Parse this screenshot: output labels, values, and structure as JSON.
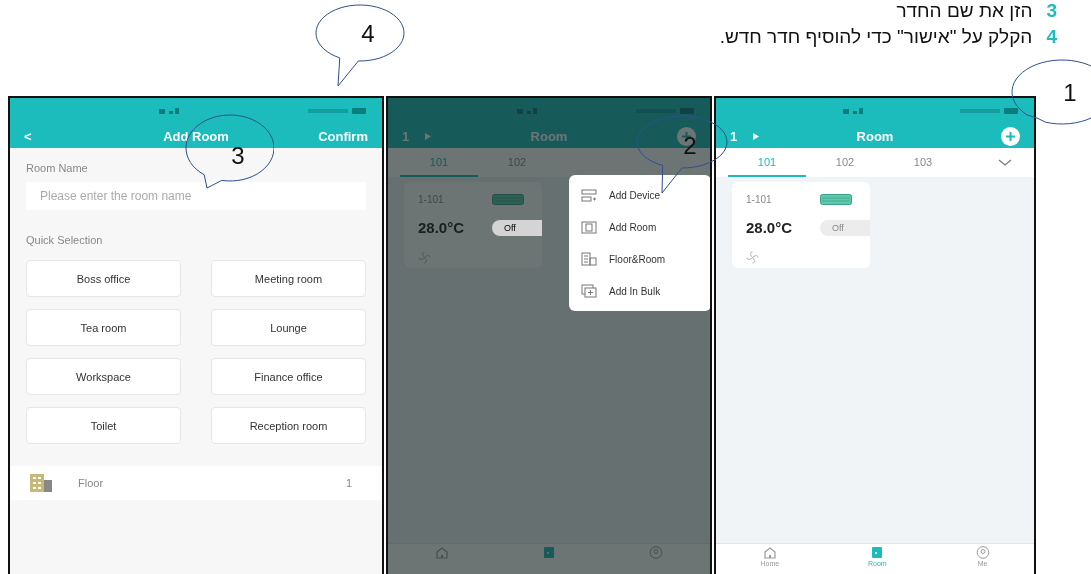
{
  "instructions": [
    {
      "number": "3",
      "text": "הזן את שם החדר"
    },
    {
      "number": "4",
      "text": "הקלק על \"אישור\" כדי להוסיף חדר חדש."
    }
  ],
  "screens": [
    {
      "kind": "add_room",
      "header": {
        "back": "<",
        "title": "Add Room",
        "action": "Confirm"
      },
      "room_name_label": "Room Name",
      "room_name_field": {
        "placeholder": "Please enter the room name"
      },
      "quick_selection_label": "Quick Selection",
      "quick_options": [
        "Boss office",
        "Meeting room",
        "Tea room",
        "Lounge",
        "Workspace",
        "Finance office",
        "Toilet",
        "Reception room"
      ],
      "floor": {
        "label": "Floor",
        "value": "1"
      }
    },
    {
      "kind": "room_menu",
      "header": {
        "floor": "1",
        "title": "Room"
      },
      "tabs": [
        {
          "label": "101",
          "selected": true
        },
        {
          "label": "102",
          "selected": false
        }
      ],
      "device_card": {
        "name": "1-101",
        "temperature": "28.0°C",
        "status": "Off"
      },
      "menu": [
        {
          "kind": "device",
          "label": "Add Device"
        },
        {
          "kind": "room",
          "label": "Add Room"
        },
        {
          "kind": "floor",
          "label": "Floor&Room"
        },
        {
          "kind": "bulk",
          "label": "Add In Bulk"
        }
      ],
      "nav": [
        {
          "kind": "home",
          "selected": false
        },
        {
          "kind": "room",
          "selected": true
        },
        {
          "kind": "me",
          "selected": false
        }
      ]
    },
    {
      "kind": "room",
      "header": {
        "floor": "1",
        "title": "Room"
      },
      "tabs": [
        {
          "label": "101",
          "selected": true
        },
        {
          "label": "102",
          "selected": false
        },
        {
          "label": "103",
          "selected": false
        }
      ],
      "device_card": {
        "name": "1-101",
        "temperature": "28.0°C",
        "status": "Off"
      },
      "nav": [
        {
          "kind": "home",
          "label": "Home",
          "selected": false
        },
        {
          "kind": "room",
          "label": "Room",
          "selected": true
        },
        {
          "kind": "me",
          "label": "Me",
          "selected": false
        }
      ]
    }
  ],
  "callouts": [
    {
      "number": "1"
    },
    {
      "number": "2"
    },
    {
      "number": "3"
    },
    {
      "number": "4"
    }
  ]
}
